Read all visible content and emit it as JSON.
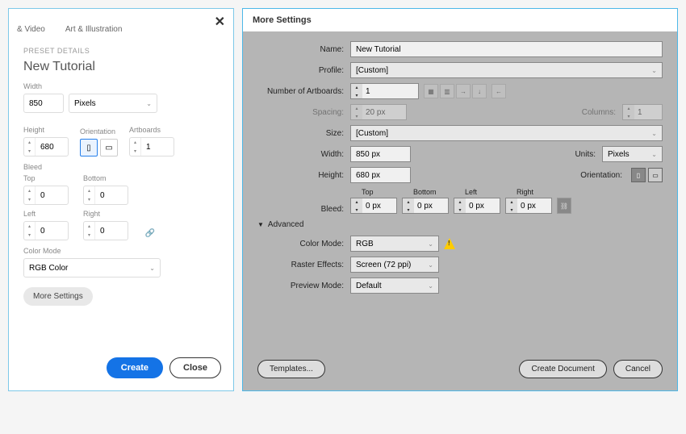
{
  "left": {
    "tabs": {
      "video": "& Video",
      "art": "Art & Illustration"
    },
    "presetLabel": "PRESET DETAILS",
    "docTitle": "New Tutorial",
    "labels": {
      "width": "Width",
      "height": "Height",
      "orientation": "Orientation",
      "artboards": "Artboards",
      "bleed": "Bleed",
      "top": "Top",
      "bottom": "Bottom",
      "left": "Left",
      "right": "Right",
      "colorMode": "Color Mode"
    },
    "width": "850",
    "units": "Pixels",
    "height": "680",
    "artboards": "1",
    "bleed": {
      "top": "0",
      "bottom": "0",
      "left": "0",
      "right": "0"
    },
    "colorMode": "RGB Color",
    "moreSettings": "More Settings",
    "create": "Create",
    "close": "Close"
  },
  "right": {
    "title": "More Settings",
    "labels": {
      "name": "Name:",
      "profile": "Profile:",
      "numArtboards": "Number of Artboards:",
      "spacing": "Spacing:",
      "columns": "Columns:",
      "size": "Size:",
      "width": "Width:",
      "units": "Units:",
      "height": "Height:",
      "orientation": "Orientation:",
      "bleed": "Bleed:",
      "top": "Top",
      "bottom": "Bottom",
      "left": "Left",
      "rightL": "Right",
      "advanced": "Advanced",
      "colorMode": "Color Mode:",
      "raster": "Raster Effects:",
      "preview": "Preview Mode:"
    },
    "name": "New Tutorial",
    "profile": "[Custom]",
    "numArtboards": "1",
    "spacing": "20 px",
    "columns": "1",
    "size": "[Custom]",
    "width": "850 px",
    "units": "Pixels",
    "height": "680 px",
    "bleed": {
      "top": "0 px",
      "bottom": "0 px",
      "left": "0 px",
      "right": "0 px"
    },
    "colorMode": "RGB",
    "raster": "Screen (72 ppi)",
    "preview": "Default",
    "templates": "Templates...",
    "createDoc": "Create Document",
    "cancel": "Cancel"
  }
}
